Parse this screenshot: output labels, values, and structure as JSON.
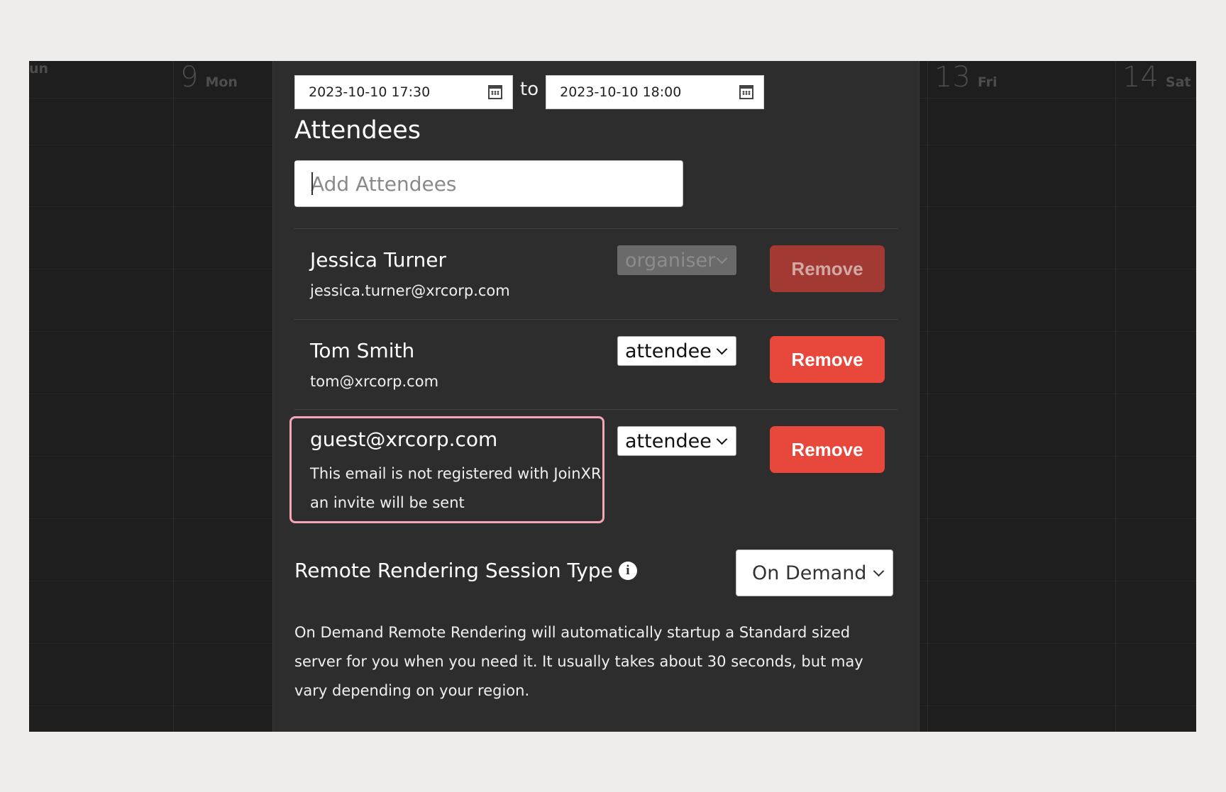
{
  "calendar": {
    "days": [
      {
        "num": "",
        "dow": "un"
      },
      {
        "num": "9",
        "dow": "Mon"
      },
      {
        "num": "13",
        "dow": "Fri"
      },
      {
        "num": "14",
        "dow": "Sat"
      }
    ]
  },
  "event": {
    "start": "2023-10-10 17:30",
    "to_label": "to",
    "end": "2023-10-10 18:00"
  },
  "attendees": {
    "title": "Attendees",
    "add_placeholder": "Add Attendees",
    "remove_label": "Remove",
    "list": [
      {
        "name": "Jessica Turner",
        "email": "jessica.turner@xrcorp.com",
        "role": "organiser"
      },
      {
        "name": "Tom Smith",
        "email": "tom@xrcorp.com",
        "role": "attendee"
      }
    ],
    "guest": {
      "email": "guest@xrcorp.com",
      "note_line1": "This email is not registered with JoinXR",
      "note_line2": "an invite will be sent",
      "role": "attendee"
    }
  },
  "remote_rendering": {
    "label": "Remote Rendering Session Type",
    "info_icon": "i",
    "selected": "On Demand",
    "description": "On Demand Remote Rendering will automatically startup a Standard sized server for you when you need it. It usually takes about 30 seconds, but may vary depending on your region."
  },
  "colors": {
    "remove_red": "#e8473b",
    "highlight_pink": "#f6a5b7",
    "modal_bg": "#2d2d2d"
  }
}
